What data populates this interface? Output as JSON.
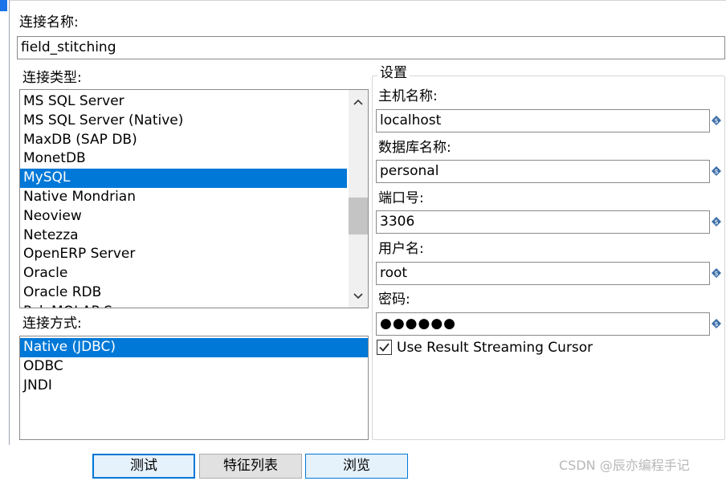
{
  "connection_name": {
    "label": "连接名称:",
    "value": "field_stitching"
  },
  "connection_type": {
    "label": "连接类型:",
    "items": [
      "MS SQL Server",
      "MS SQL Server (Native)",
      "MaxDB (SAP DB)",
      "MonetDB",
      "MySQL",
      "Native Mondrian",
      "Neoview",
      "Netezza",
      "OpenERP Server",
      "Oracle",
      "Oracle RDB",
      "PaloMOLAP Server"
    ],
    "selected": "MySQL"
  },
  "access_method": {
    "label": "连接方式:",
    "items": [
      "Native (JDBC)",
      "ODBC",
      "JNDI"
    ],
    "selected": "Native (JDBC)"
  },
  "settings": {
    "title": "设置",
    "host_label": "主机名称:",
    "host_value": "localhost",
    "database_label": "数据库名称:",
    "database_value": "personal",
    "port_label": "端口号:",
    "port_value": "3306",
    "username_label": "用户名:",
    "username_value": "root",
    "password_label": "密码:",
    "password_value": "●●●●●●",
    "streaming_cursor_label": "Use Result Streaming Cursor",
    "streaming_cursor_checked": true
  },
  "buttons": {
    "test": "测试",
    "feature_list": "特征列表",
    "browse": "浏览"
  },
  "watermark": "CSDN @辰亦编程手记",
  "colors": {
    "selection": "#0078d7",
    "variable_icon": "#3b6ea8"
  },
  "icons": {
    "variable": "diamond-variable-icon",
    "scroll_up": "chevron-up-icon",
    "scroll_down": "chevron-down-icon",
    "checkbox": "checkmark-icon"
  }
}
